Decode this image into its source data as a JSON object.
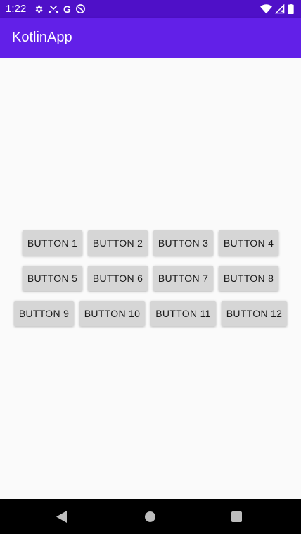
{
  "status_bar": {
    "time": "1:22",
    "left_icons": [
      "gear-icon",
      "missed-call-icon",
      "google-g-icon",
      "data-saver-icon"
    ],
    "google_letter": "G",
    "right_icons": [
      "wifi-icon",
      "cell-signal-icon",
      "battery-icon"
    ]
  },
  "app_bar": {
    "title": "KotlinApp",
    "color": "#6220E8"
  },
  "buttons": {
    "row1": [
      "BUTTON 1",
      "BUTTON 2",
      "BUTTON 3",
      "BUTTON 4"
    ],
    "row2": [
      "BUTTON 5",
      "BUTTON 6",
      "BUTTON 7",
      "BUTTON 8"
    ],
    "row3": [
      "BUTTON 9",
      "BUTTON 10",
      "BUTTON 11",
      "BUTTON 12"
    ]
  },
  "nav_bar": {
    "icons": [
      "back-icon",
      "home-icon",
      "recents-icon"
    ]
  }
}
